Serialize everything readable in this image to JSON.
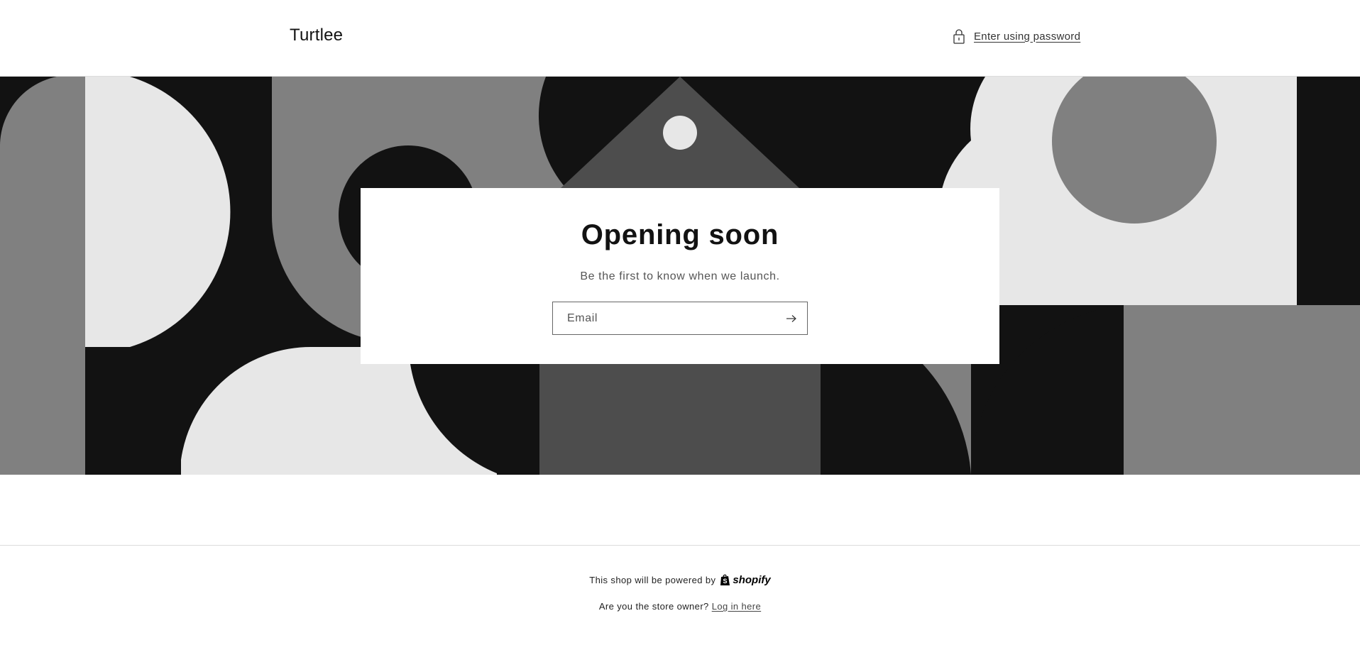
{
  "header": {
    "logo": "Turtlee",
    "password_link": "Enter using password"
  },
  "hero": {
    "title": "Opening soon",
    "subtitle": "Be the first to know when we launch.",
    "email_placeholder": "Email"
  },
  "footer": {
    "powered_text": "This shop will be powered by",
    "shopify_logo": "shopify",
    "owner_text": "Are you the store owner?",
    "login_link": "Log in here"
  },
  "icons": {
    "lock": "lock-icon",
    "arrow": "arrow-right-icon",
    "shopify_bag": "shopify-bag-icon"
  },
  "colors": {
    "black": "#121212",
    "dark_gray": "#4d4d4d",
    "mid_gray": "#808080",
    "light_gray": "#e7e7e7",
    "white": "#ffffff"
  }
}
